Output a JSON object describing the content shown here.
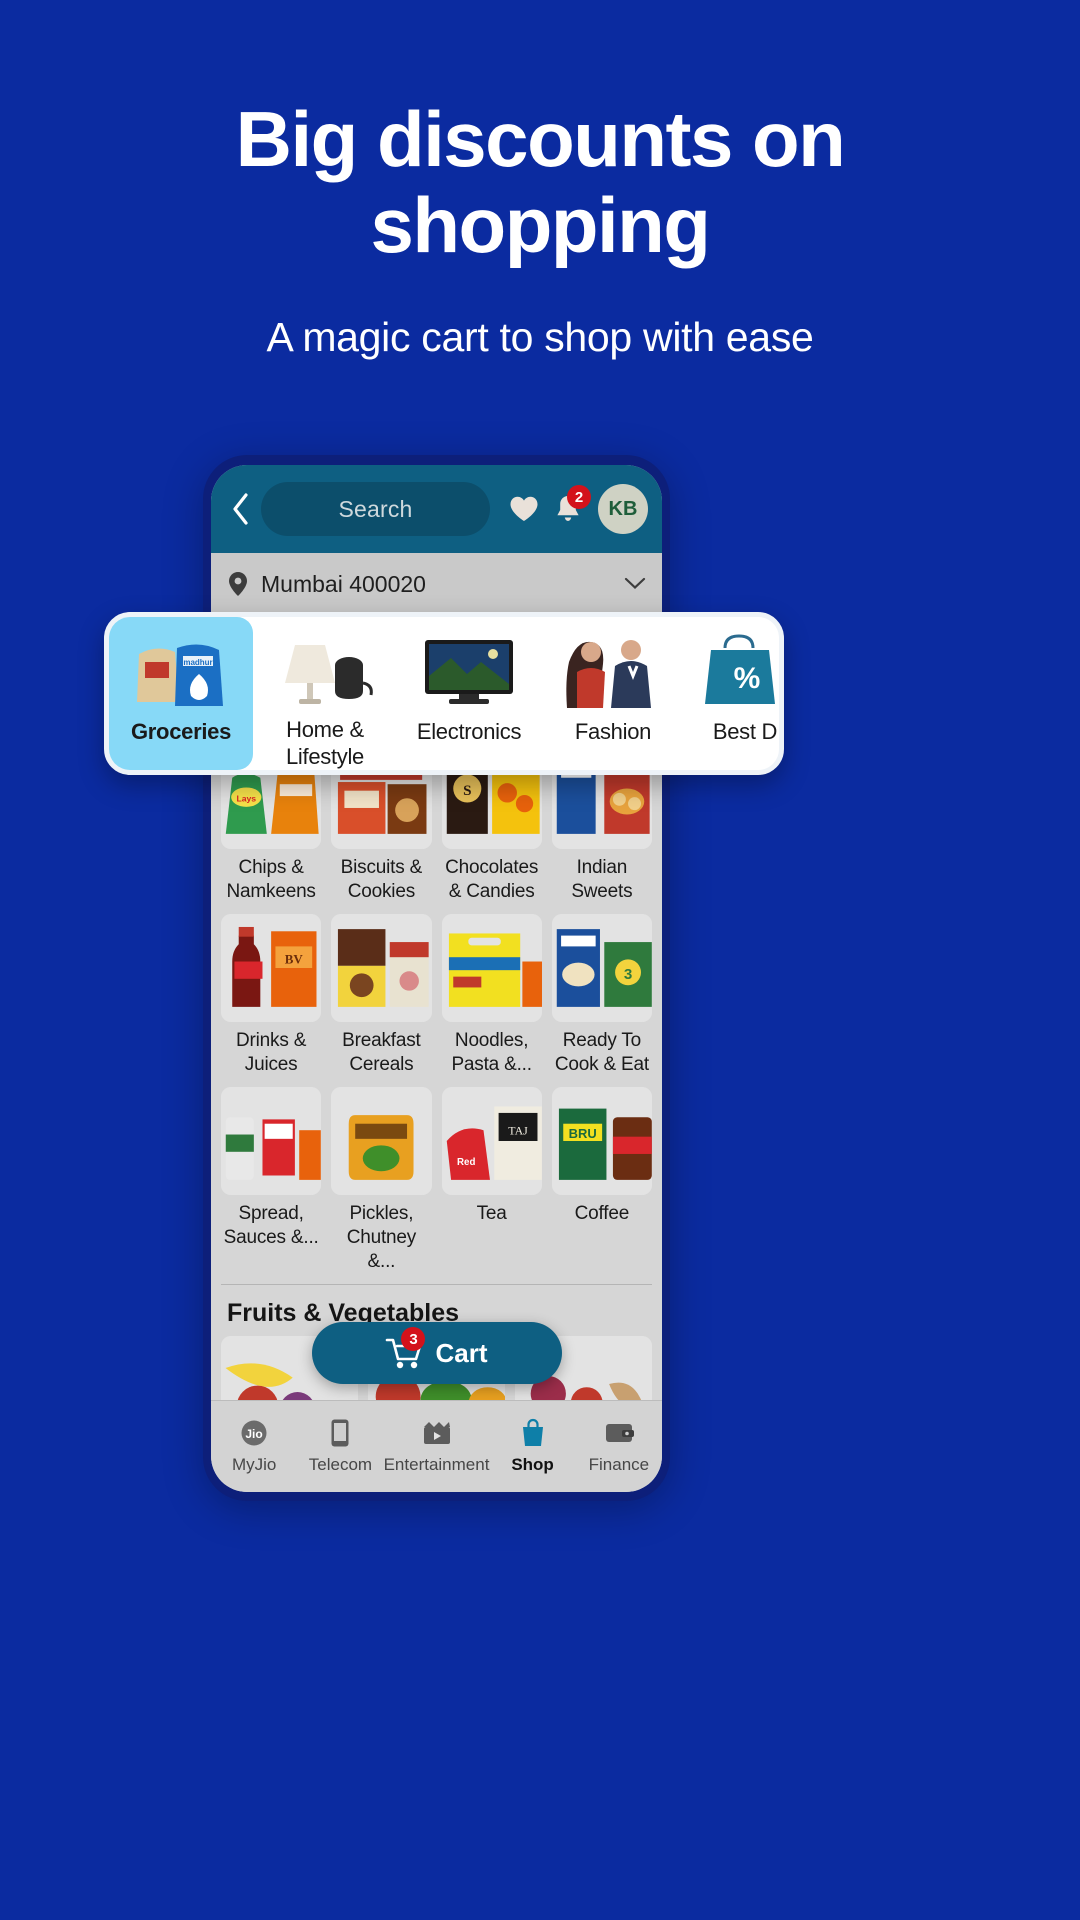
{
  "promo": {
    "title": "Big discounts on shopping",
    "subtitle": "A magic cart to shop with ease",
    "background_color": "#0b2ba0",
    "text_color": "#ffffff"
  },
  "app": {
    "header": {
      "back_icon": "chevron-left-icon",
      "search_placeholder": "Search",
      "wishlist_icon": "heart-icon",
      "notification_icon": "bell-icon",
      "notification_count": "2",
      "avatar_initials": "KB",
      "background_color": "#0e5f82"
    },
    "location": {
      "pin_icon": "location-pin-icon",
      "text": "Mumbai 400020",
      "caret_icon": "chevron-down-icon"
    },
    "categories": {
      "selected": "Groceries",
      "selected_color": "#87d9f7",
      "items": [
        {
          "label": "Groceries",
          "icon": "groceries-icon",
          "selected": true
        },
        {
          "label": "Home & Lifestyle",
          "icon": "home-lifestyle-icon",
          "selected": false
        },
        {
          "label": "Electronics",
          "icon": "electronics-icon",
          "selected": false
        },
        {
          "label": "Fashion",
          "icon": "fashion-icon",
          "selected": false
        },
        {
          "label": "Best D",
          "icon": "best-deals-icon",
          "selected": false
        }
      ]
    },
    "grocery_grid": [
      {
        "label": "Chips & Namkeens",
        "icon": "chips-namkeens-icon"
      },
      {
        "label": "Biscuits & Cookies",
        "icon": "biscuits-cookies-icon"
      },
      {
        "label": "Chocolates & Candies",
        "icon": "chocolates-candies-icon"
      },
      {
        "label": "Indian Sweets",
        "icon": "indian-sweets-icon"
      },
      {
        "label": "Drinks & Juices",
        "icon": "drinks-juices-icon"
      },
      {
        "label": "Breakfast Cereals",
        "icon": "breakfast-cereals-icon"
      },
      {
        "label": "Noodles, Pasta &...",
        "icon": "noodles-pasta-icon"
      },
      {
        "label": "Ready To Cook & Eat",
        "icon": "ready-to-cook-icon"
      },
      {
        "label": "Spread, Sauces &...",
        "icon": "spread-sauces-icon"
      },
      {
        "label": "Pickles, Chutney &...",
        "icon": "pickles-chutney-icon"
      },
      {
        "label": "Tea",
        "icon": "tea-icon"
      },
      {
        "label": "Coffee",
        "icon": "coffee-icon"
      }
    ],
    "fruits_section": {
      "title": "Fruits & Vegetables",
      "tiles": [
        {
          "icon": "banana-apple-icon"
        },
        {
          "icon": "mixed-vegetables-icon"
        },
        {
          "icon": "berries-ginger-icon"
        }
      ]
    },
    "cart_fab": {
      "label": "Cart",
      "icon": "shopping-cart-icon",
      "count": "3",
      "color": "#0e5f82"
    },
    "bottom_nav": {
      "active": "Shop",
      "items": [
        {
          "label": "MyJio",
          "icon": "jio-logo-icon",
          "active": false
        },
        {
          "label": "Telecom",
          "icon": "mobile-phone-icon",
          "active": false
        },
        {
          "label": "Entertainment",
          "icon": "clapperboard-icon",
          "active": false
        },
        {
          "label": "Shop",
          "icon": "shopping-bag-icon",
          "active": true
        },
        {
          "label": "Finance",
          "icon": "wallet-icon",
          "active": false
        }
      ]
    }
  }
}
